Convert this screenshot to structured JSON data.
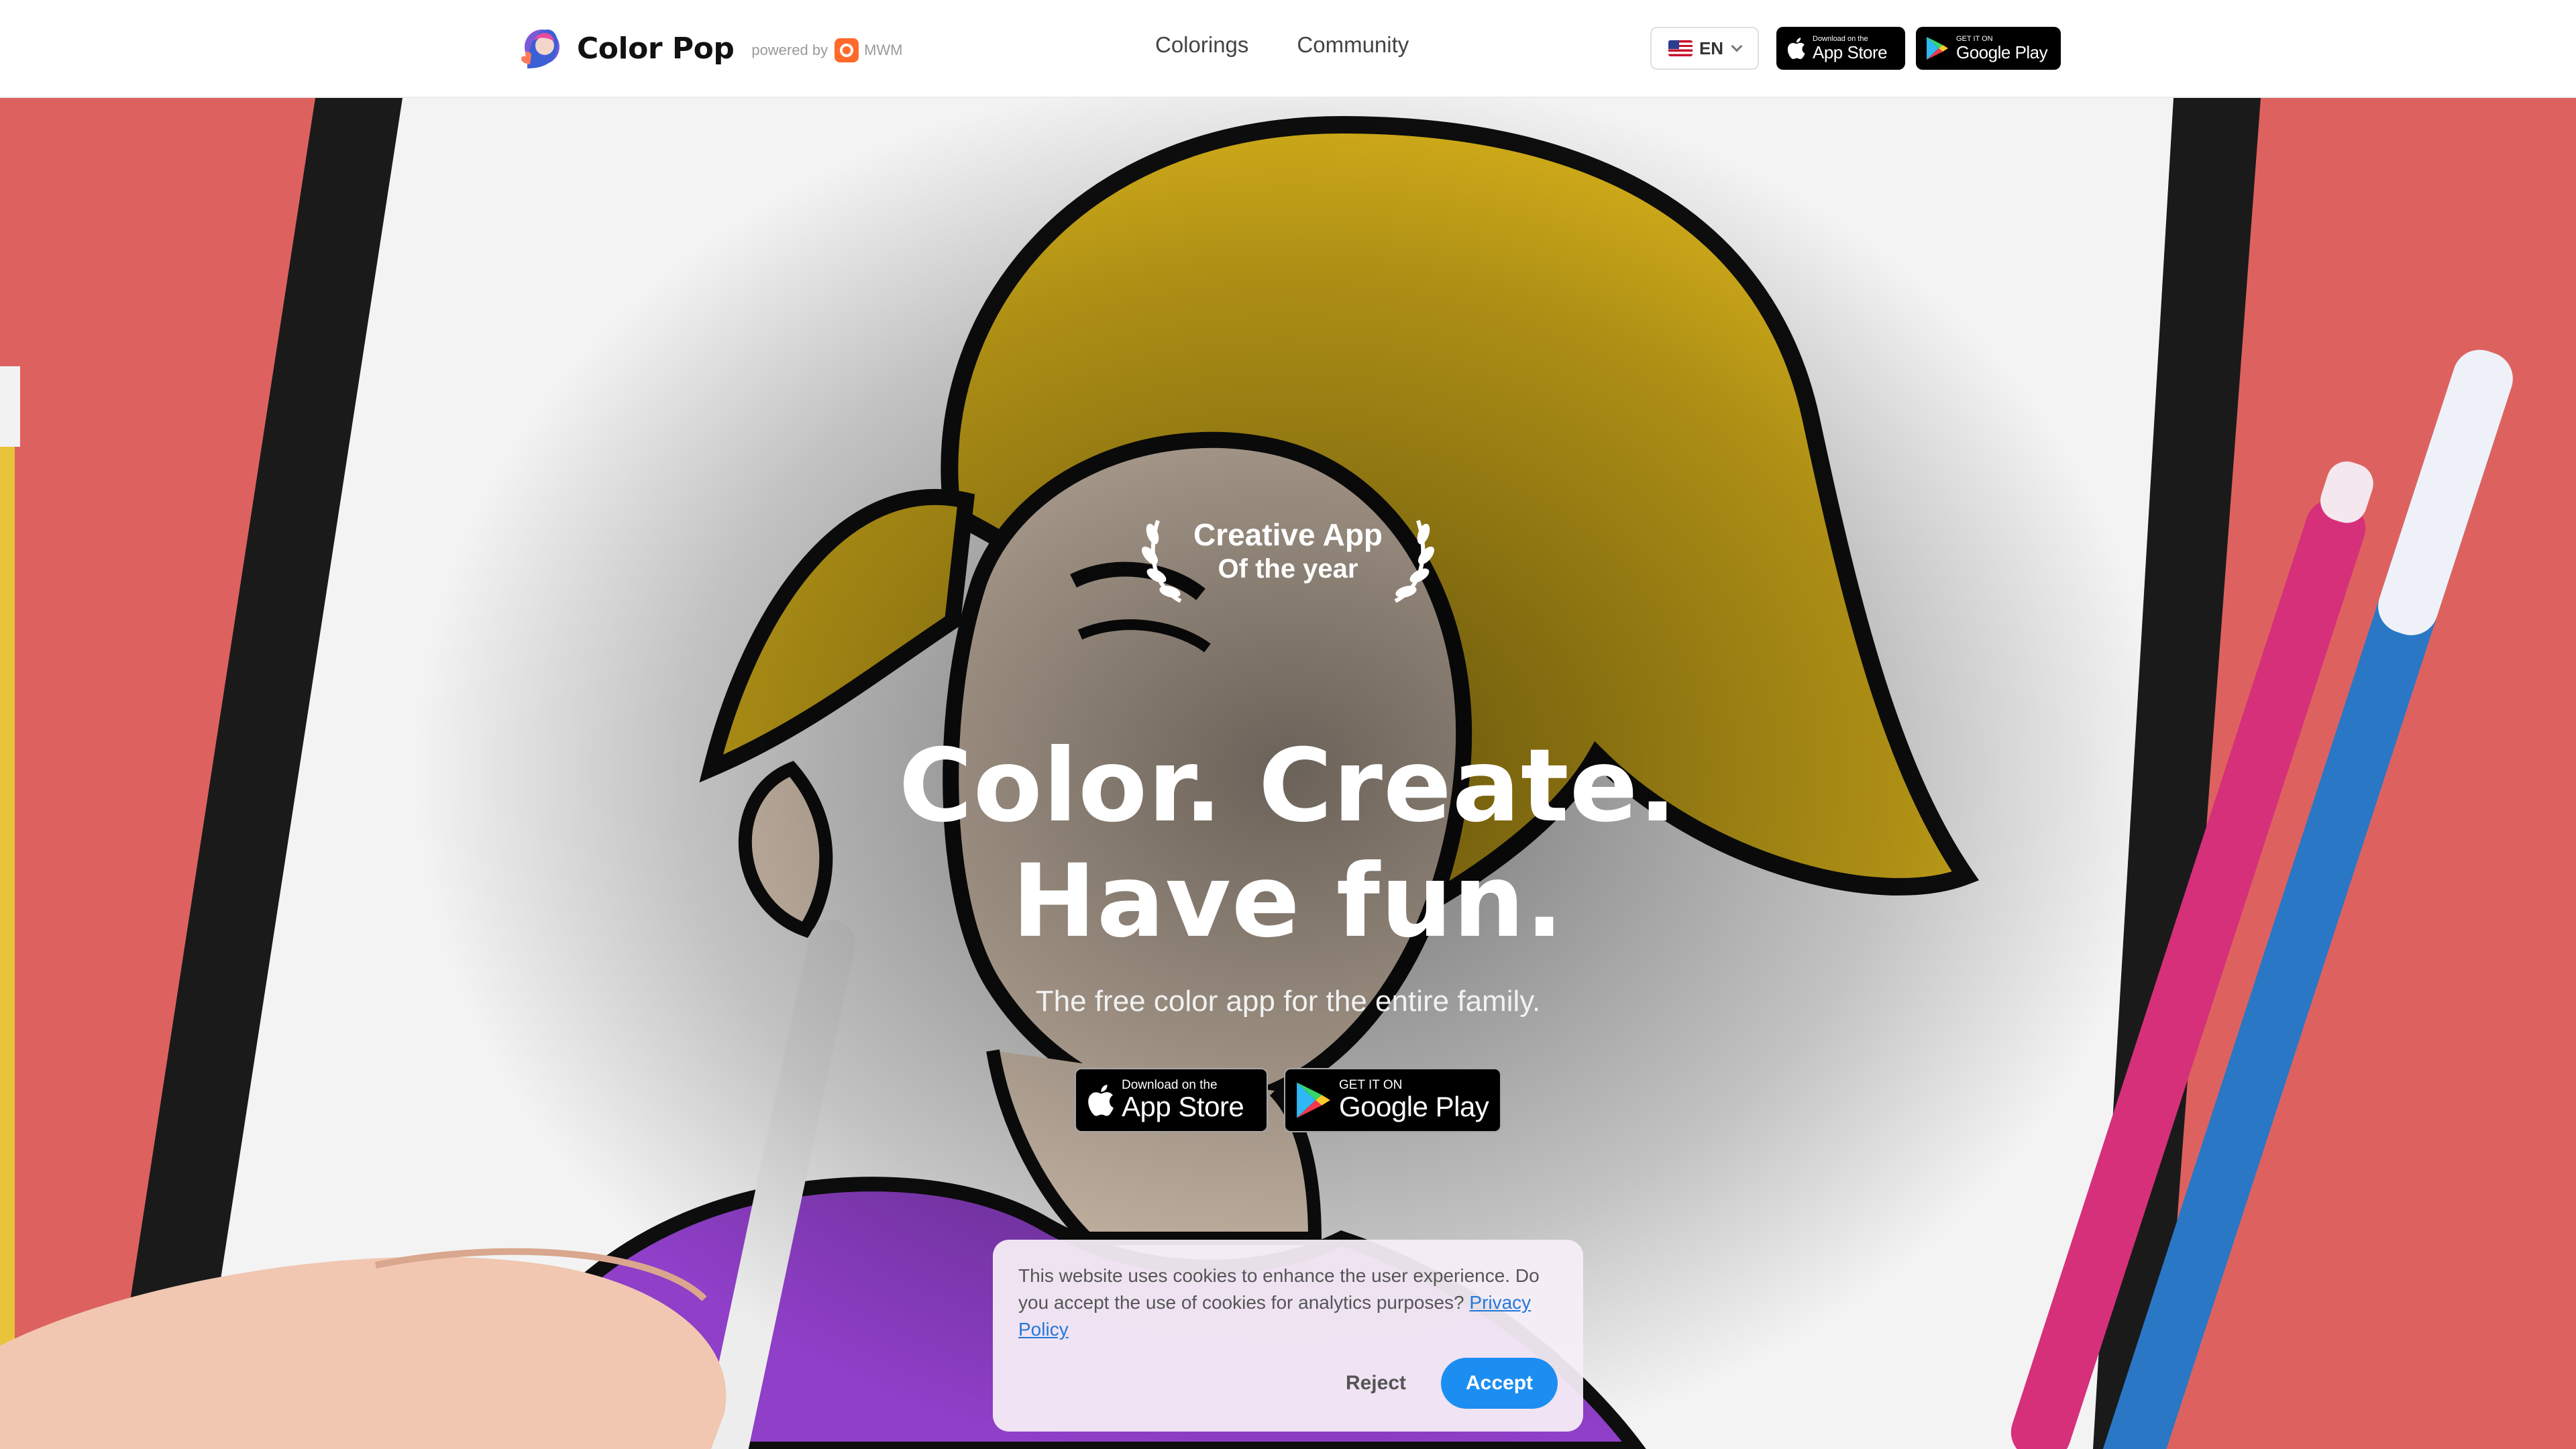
{
  "header": {
    "brand": "Color Pop",
    "powered_by": "powered by",
    "mwm": "MWM",
    "nav": [
      {
        "label": "Colorings"
      },
      {
        "label": "Community"
      }
    ],
    "language": "EN",
    "app_store": {
      "small": "Download on the",
      "big": "App Store"
    },
    "google_play": {
      "small": "GET IT ON",
      "big": "Google Play"
    }
  },
  "hero": {
    "award_title": "Creative App",
    "award_sub": "Of the year",
    "headline_line1": "Color. Create.",
    "headline_line2": "Have fun.",
    "subline": "The free color app for the entire family.",
    "app_store": {
      "small": "Download on the",
      "big": "App Store"
    },
    "google_play": {
      "small": "GET IT ON",
      "big": "Google Play"
    }
  },
  "cookie": {
    "text": "This website uses cookies to enhance the user experience. Do you accept the use of cookies for analytics purposes?",
    "policy_link": "Privacy Policy",
    "reject": "Reject",
    "accept": "Accept"
  },
  "colors": {
    "accent": "#1c8ef2",
    "background_red": "#e06a66",
    "hair_yellow": "#d8b21a",
    "shirt_purple": "#8f3fc8",
    "mwm_orange": "#ff6a2b"
  }
}
